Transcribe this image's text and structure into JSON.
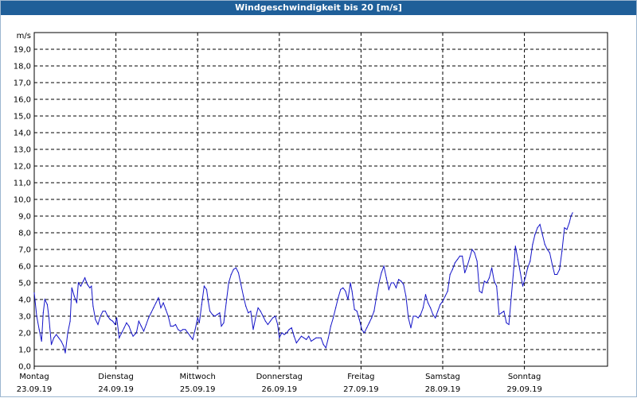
{
  "window": {
    "title": "Windgeschwindigkeit bis 20 [m/s]"
  },
  "chart_data": {
    "type": "line",
    "title": "Windgeschwindigkeit bis 20 [m/s]",
    "ylabel": "m/s",
    "xlabel": "",
    "ylim": [
      0,
      20
    ],
    "xlim": [
      0,
      7
    ],
    "grid": true,
    "y_ticks": [
      0,
      1,
      2,
      3,
      4,
      5,
      6,
      7,
      8,
      9,
      10,
      11,
      12,
      13,
      14,
      15,
      16,
      17,
      18,
      19
    ],
    "y_tick_labels": [
      "0,0",
      "1,0",
      "2,0",
      "3,0",
      "4,0",
      "5,0",
      "6,0",
      "7,0",
      "8,0",
      "9,0",
      "10,0",
      "11,0",
      "12,0",
      "13,0",
      "14,0",
      "15,0",
      "16,0",
      "17,0",
      "18,0",
      "19,0"
    ],
    "x_tick_labels": [
      {
        "day": "Montag",
        "date": "23.09.19"
      },
      {
        "day": "Dienstag",
        "date": "24.09.19"
      },
      {
        "day": "Mittwoch",
        "date": "25.09.19"
      },
      {
        "day": "Donnerstag",
        "date": "26.09.19"
      },
      {
        "day": "Freitag",
        "date": "27.09.19"
      },
      {
        "day": "Samstag",
        "date": "28.09.19"
      },
      {
        "day": "Sonntag",
        "date": "29.09.19"
      }
    ],
    "line_color": "#1414c8",
    "series": [
      {
        "values": [
          [
            0.0,
            4.4
          ],
          [
            0.03,
            3.0
          ],
          [
            0.06,
            2.2
          ],
          [
            0.09,
            1.5
          ],
          [
            0.11,
            3.2
          ],
          [
            0.13,
            4.0
          ],
          [
            0.16,
            3.7
          ],
          [
            0.18,
            2.9
          ],
          [
            0.21,
            1.3
          ],
          [
            0.24,
            1.7
          ],
          [
            0.27,
            1.9
          ],
          [
            0.3,
            1.7
          ],
          [
            0.33,
            1.5
          ],
          [
            0.36,
            1.2
          ],
          [
            0.38,
            0.8
          ],
          [
            0.41,
            2.0
          ],
          [
            0.44,
            2.7
          ],
          [
            0.46,
            4.7
          ],
          [
            0.49,
            4.2
          ],
          [
            0.52,
            3.8
          ],
          [
            0.54,
            5.0
          ],
          [
            0.57,
            4.8
          ],
          [
            0.6,
            5.1
          ],
          [
            0.62,
            5.3
          ],
          [
            0.65,
            4.9
          ],
          [
            0.68,
            4.7
          ],
          [
            0.7,
            4.8
          ],
          [
            0.72,
            3.6
          ],
          [
            0.75,
            2.8
          ],
          [
            0.78,
            2.5
          ],
          [
            0.81,
            3.0
          ],
          [
            0.84,
            3.3
          ],
          [
            0.87,
            3.3
          ],
          [
            0.9,
            3.0
          ],
          [
            0.93,
            2.8
          ],
          [
            0.96,
            2.7
          ],
          [
            0.99,
            2.5
          ],
          [
            1.01,
            2.9
          ],
          [
            1.04,
            1.7
          ],
          [
            1.07,
            2.0
          ],
          [
            1.1,
            2.3
          ],
          [
            1.13,
            2.6
          ],
          [
            1.16,
            2.4
          ],
          [
            1.19,
            2.0
          ],
          [
            1.21,
            1.8
          ],
          [
            1.25,
            2.0
          ],
          [
            1.28,
            2.7
          ],
          [
            1.31,
            2.4
          ],
          [
            1.34,
            2.1
          ],
          [
            1.37,
            2.5
          ],
          [
            1.4,
            2.9
          ],
          [
            1.43,
            3.2
          ],
          [
            1.46,
            3.5
          ],
          [
            1.49,
            3.8
          ],
          [
            1.52,
            4.1
          ],
          [
            1.55,
            3.5
          ],
          [
            1.58,
            3.8
          ],
          [
            1.61,
            3.4
          ],
          [
            1.64,
            3.0
          ],
          [
            1.67,
            2.4
          ],
          [
            1.7,
            2.4
          ],
          [
            1.73,
            2.5
          ],
          [
            1.76,
            2.2
          ],
          [
            1.79,
            2.1
          ],
          [
            1.82,
            2.2
          ],
          [
            1.85,
            2.2
          ],
          [
            1.88,
            2.0
          ],
          [
            1.91,
            1.8
          ],
          [
            1.94,
            1.6
          ],
          [
            1.97,
            2.2
          ],
          [
            2.0,
            2.9
          ],
          [
            2.02,
            2.6
          ],
          [
            2.05,
            3.7
          ],
          [
            2.08,
            4.8
          ],
          [
            2.11,
            4.6
          ],
          [
            2.13,
            3.9
          ],
          [
            2.15,
            3.3
          ],
          [
            2.18,
            3.1
          ],
          [
            2.21,
            3.0
          ],
          [
            2.24,
            3.1
          ],
          [
            2.27,
            3.2
          ],
          [
            2.29,
            2.4
          ],
          [
            2.32,
            2.6
          ],
          [
            2.35,
            3.8
          ],
          [
            2.38,
            5.0
          ],
          [
            2.41,
            5.5
          ],
          [
            2.44,
            5.8
          ],
          [
            2.47,
            5.9
          ],
          [
            2.5,
            5.6
          ],
          [
            2.53,
            4.9
          ],
          [
            2.56,
            4.2
          ],
          [
            2.59,
            3.6
          ],
          [
            2.62,
            3.2
          ],
          [
            2.65,
            3.3
          ],
          [
            2.68,
            2.2
          ],
          [
            2.71,
            2.9
          ],
          [
            2.74,
            3.5
          ],
          [
            2.77,
            3.3
          ],
          [
            2.8,
            3.0
          ],
          [
            2.83,
            2.7
          ],
          [
            2.86,
            2.5
          ],
          [
            2.89,
            2.7
          ],
          [
            2.92,
            2.9
          ],
          [
            2.95,
            3.0
          ],
          [
            2.98,
            2.5
          ],
          [
            3.0,
            1.7
          ],
          [
            3.03,
            2.0
          ],
          [
            3.06,
            1.9
          ],
          [
            3.09,
            2.0
          ],
          [
            3.12,
            2.2
          ],
          [
            3.15,
            2.3
          ],
          [
            3.18,
            1.8
          ],
          [
            3.21,
            1.4
          ],
          [
            3.24,
            1.6
          ],
          [
            3.27,
            1.8
          ],
          [
            3.3,
            1.7
          ],
          [
            3.33,
            1.6
          ],
          [
            3.36,
            1.8
          ],
          [
            3.39,
            1.5
          ],
          [
            3.42,
            1.6
          ],
          [
            3.45,
            1.7
          ],
          [
            3.48,
            1.7
          ],
          [
            3.51,
            1.7
          ],
          [
            3.54,
            1.3
          ],
          [
            3.57,
            1.1
          ],
          [
            3.6,
            1.7
          ],
          [
            3.63,
            2.4
          ],
          [
            3.66,
            2.9
          ],
          [
            3.69,
            3.5
          ],
          [
            3.72,
            4.1
          ],
          [
            3.75,
            4.6
          ],
          [
            3.78,
            4.7
          ],
          [
            3.81,
            4.5
          ],
          [
            3.84,
            4.0
          ],
          [
            3.87,
            5.0
          ],
          [
            3.89,
            4.5
          ],
          [
            3.92,
            3.4
          ],
          [
            3.95,
            3.3
          ],
          [
            3.98,
            2.8
          ],
          [
            4.01,
            2.2
          ],
          [
            4.04,
            2.0
          ],
          [
            4.07,
            2.3
          ],
          [
            4.1,
            2.6
          ],
          [
            4.13,
            2.9
          ],
          [
            4.16,
            3.3
          ],
          [
            4.19,
            4.2
          ],
          [
            4.22,
            5.0
          ],
          [
            4.25,
            5.6
          ],
          [
            4.28,
            6.0
          ],
          [
            4.31,
            5.3
          ],
          [
            4.34,
            4.6
          ],
          [
            4.37,
            5.0
          ],
          [
            4.4,
            5.0
          ],
          [
            4.43,
            4.7
          ],
          [
            4.46,
            5.2
          ],
          [
            4.49,
            5.1
          ],
          [
            4.52,
            4.9
          ],
          [
            4.55,
            4.2
          ],
          [
            4.58,
            2.9
          ],
          [
            4.61,
            2.3
          ],
          [
            4.64,
            3.0
          ],
          [
            4.67,
            3.0
          ],
          [
            4.7,
            2.9
          ],
          [
            4.73,
            3.1
          ],
          [
            4.76,
            3.5
          ],
          [
            4.79,
            4.3
          ],
          [
            4.82,
            3.8
          ],
          [
            4.85,
            3.5
          ],
          [
            4.88,
            3.1
          ],
          [
            4.91,
            2.9
          ],
          [
            4.94,
            3.3
          ],
          [
            4.97,
            3.7
          ],
          [
            5.0,
            3.9
          ],
          [
            5.03,
            4.2
          ],
          [
            5.06,
            4.5
          ],
          [
            5.09,
            5.5
          ],
          [
            5.12,
            5.8
          ],
          [
            5.15,
            6.2
          ],
          [
            5.18,
            6.4
          ],
          [
            5.21,
            6.6
          ],
          [
            5.24,
            6.6
          ],
          [
            5.27,
            5.6
          ],
          [
            5.3,
            6.0
          ],
          [
            5.33,
            6.5
          ],
          [
            5.36,
            7.0
          ],
          [
            5.39,
            6.8
          ],
          [
            5.42,
            6.3
          ],
          [
            5.45,
            4.5
          ],
          [
            5.48,
            4.4
          ],
          [
            5.51,
            5.1
          ],
          [
            5.54,
            5.0
          ],
          [
            5.57,
            5.3
          ],
          [
            5.6,
            5.9
          ],
          [
            5.63,
            5.1
          ],
          [
            5.66,
            4.8
          ],
          [
            5.69,
            3.1
          ],
          [
            5.72,
            3.2
          ],
          [
            5.75,
            3.3
          ],
          [
            5.78,
            2.6
          ],
          [
            5.81,
            2.5
          ],
          [
            5.84,
            4.2
          ],
          [
            5.87,
            5.9
          ],
          [
            5.89,
            7.2
          ],
          [
            5.92,
            6.4
          ],
          [
            5.95,
            5.6
          ],
          [
            5.98,
            4.8
          ],
          [
            6.01,
            5.3
          ],
          [
            6.04,
            5.9
          ],
          [
            6.07,
            6.3
          ],
          [
            6.1,
            7.3
          ],
          [
            6.13,
            7.9
          ],
          [
            6.16,
            8.3
          ],
          [
            6.19,
            8.5
          ],
          [
            6.22,
            7.9
          ],
          [
            6.25,
            7.3
          ],
          [
            6.28,
            7.0
          ],
          [
            6.31,
            6.8
          ],
          [
            6.34,
            6.1
          ],
          [
            6.37,
            5.5
          ],
          [
            6.4,
            5.5
          ],
          [
            6.43,
            5.8
          ],
          [
            6.46,
            6.9
          ],
          [
            6.49,
            8.3
          ],
          [
            6.52,
            8.2
          ],
          [
            6.55,
            8.6
          ],
          [
            6.57,
            9.0
          ],
          [
            6.59,
            9.2
          ]
        ]
      }
    ]
  }
}
